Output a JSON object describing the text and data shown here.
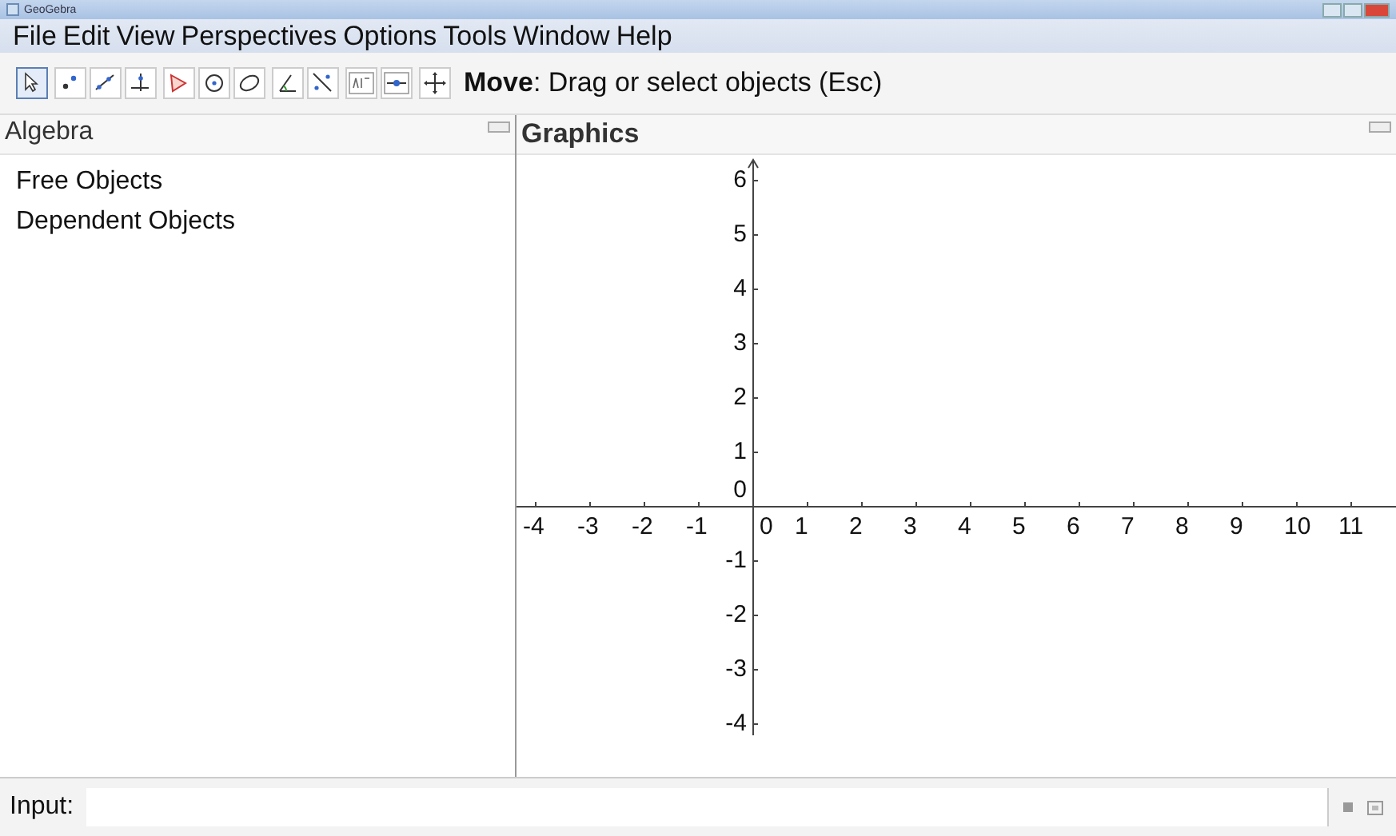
{
  "window": {
    "title": "GeoGebra"
  },
  "menu": [
    "File",
    "Edit",
    "View",
    "Perspectives",
    "Options",
    "Tools",
    "Window",
    "Help"
  ],
  "tool_groups": [
    [
      {
        "kind": "move",
        "selected": true
      }
    ],
    [
      {
        "kind": "point",
        "selected": false
      },
      {
        "kind": "line",
        "selected": false
      },
      {
        "kind": "perpendicular",
        "selected": false
      }
    ],
    [
      {
        "kind": "polygon",
        "selected": false
      },
      {
        "kind": "circle",
        "selected": false
      },
      {
        "kind": "ellipse",
        "selected": false
      }
    ],
    [
      {
        "kind": "angle",
        "selected": false
      },
      {
        "kind": "reflect",
        "selected": false
      }
    ],
    [
      {
        "kind": "text",
        "selected": false
      },
      {
        "kind": "slider",
        "selected": false
      }
    ],
    [
      {
        "kind": "pan",
        "selected": false
      }
    ]
  ],
  "tool_help": "**Move**: Drag or select objects (Esc)",
  "algebra": {
    "title": "Algebra",
    "items": [
      "Free Objects",
      "Dependent Objects"
    ]
  },
  "graphics": {
    "title": "Graphics",
    "x_axis_labels": [
      "-4",
      "-3",
      "-2",
      "-1",
      "0",
      "1",
      "2",
      "3",
      "4",
      "5",
      "6",
      "7",
      "8",
      "9",
      "10",
      "11"
    ],
    "y_axis_labels": [
      "6",
      "5",
      "4",
      "3",
      "2",
      "1",
      "0",
      "-1",
      "-2",
      "-3",
      "-4"
    ]
  },
  "input_bar": {
    "label": "Input:"
  }
}
